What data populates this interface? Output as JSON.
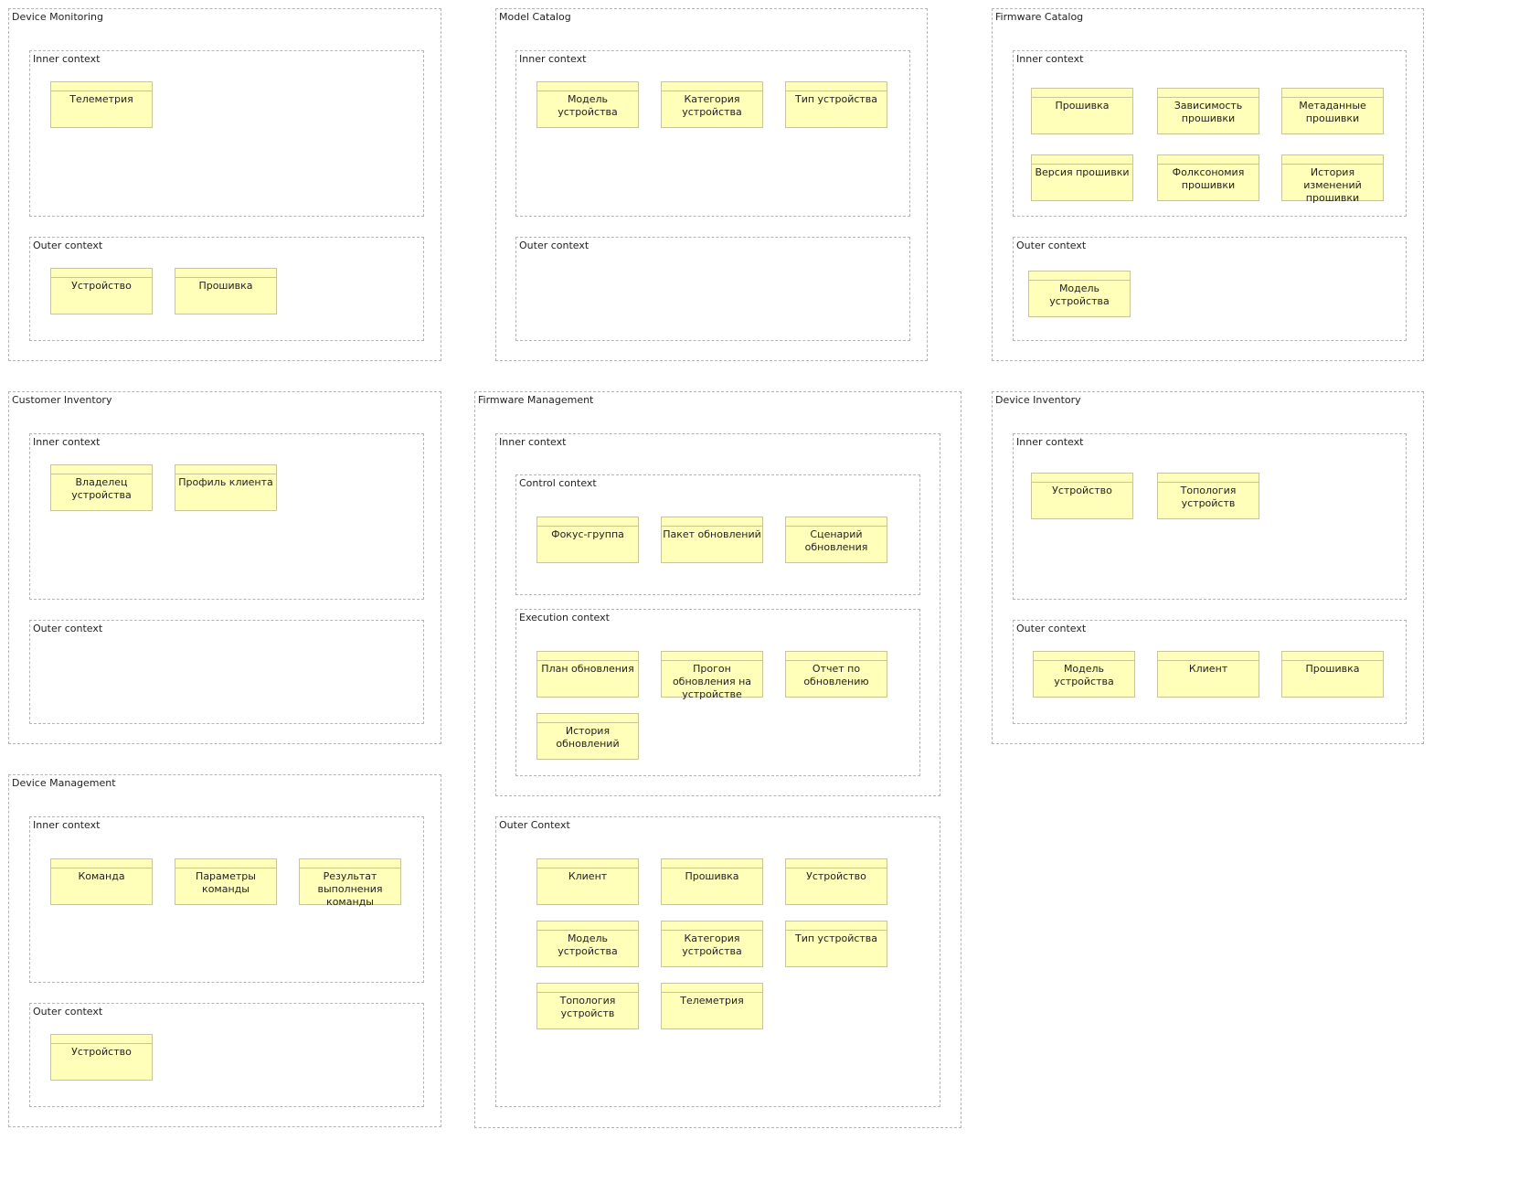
{
  "bounded_contexts": {
    "device_monitoring": {
      "title": "Device Monitoring",
      "inner": {
        "title": "Inner context",
        "entities": [
          "Телеметрия"
        ]
      },
      "outer": {
        "title": "Outer context",
        "entities": [
          "Устройство",
          "Прошивка"
        ]
      }
    },
    "model_catalog": {
      "title": "Model Catalog",
      "inner": {
        "title": "Inner context",
        "entities": [
          "Модель устройства",
          "Категория устройства",
          "Тип устройства"
        ]
      },
      "outer": {
        "title": "Outer context",
        "entities": []
      }
    },
    "firmware_catalog": {
      "title": "Firmware Catalog",
      "inner": {
        "title": "Inner context",
        "entities": [
          "Прошивка",
          "Зависимость прошивки",
          "Метаданные прошивки",
          "Версия прошивки",
          "Фолксономия прошивки",
          "История изменений прошивки"
        ]
      },
      "outer": {
        "title": "Outer context",
        "entities": [
          "Модель устройства"
        ]
      }
    },
    "customer_inventory": {
      "title": "Customer Inventory",
      "inner": {
        "title": "Inner context",
        "entities": [
          "Владелец устройства",
          "Профиль клиента"
        ]
      },
      "outer": {
        "title": "Outer context",
        "entities": []
      }
    },
    "firmware_management": {
      "title": "Firmware Management",
      "inner": {
        "title": "Inner context",
        "control": {
          "title": "Control context",
          "entities": [
            "Фокус-группа",
            "Пакет обновлений",
            "Сценарий обновления"
          ]
        },
        "execution": {
          "title": "Execution context",
          "entities": [
            "План обновления",
            "Прогон обновления на устройстве",
            "Отчет по обновлению",
            "История обновлений"
          ]
        }
      },
      "outer": {
        "title": "Outer Context",
        "entities": [
          "Клиент",
          "Прошивка",
          "Устройство",
          "Модель устройства",
          "Категория устройства",
          "Тип устройства",
          "Топология устройств",
          "Телеметрия"
        ]
      }
    },
    "device_inventory": {
      "title": "Device Inventory",
      "inner": {
        "title": "Inner context",
        "entities": [
          "Устройство",
          "Топология устройств"
        ]
      },
      "outer": {
        "title": "Outer context",
        "entities": [
          "Модель устройства",
          "Клиент",
          "Прошивка"
        ]
      }
    },
    "device_management": {
      "title": "Device Management",
      "inner": {
        "title": "Inner context",
        "entities": [
          "Команда",
          "Параметры команды",
          "Результат выполнения команды"
        ]
      },
      "outer": {
        "title": "Outer context",
        "entities": [
          "Устройство"
        ]
      }
    }
  }
}
